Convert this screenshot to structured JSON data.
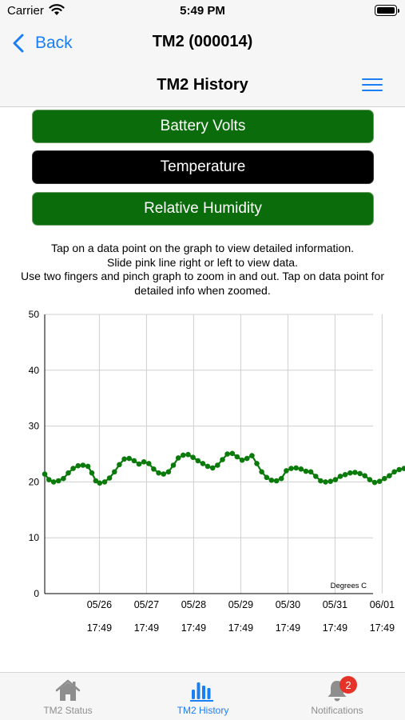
{
  "status_bar": {
    "carrier": "Carrier",
    "time": "5:49 PM"
  },
  "nav": {
    "back_label": "Back",
    "title": "TM2 (000014)"
  },
  "header": {
    "title": "TM2 History"
  },
  "buttons": {
    "battery": "Battery Volts",
    "temperature": "Temperature",
    "humidity": "Relative Humidity"
  },
  "colors": {
    "accent": "#1a7ef5",
    "button_green": "#0a6c0a",
    "button_selected": "#000000",
    "series": "#0a7a0a",
    "badge": "#e5332a"
  },
  "instructions": {
    "line1": "Tap on a data point on the graph to view detailed information.",
    "line2": "Slide pink line right or left to view data.",
    "line3": "Use two fingers and pinch graph to zoom in and out. Tap on data point for detailed info when zoomed."
  },
  "chart_data": {
    "type": "scatter",
    "title": "",
    "xlabel": "",
    "ylabel": "",
    "unit_label": "Degrees C",
    "ylim": [
      0,
      50
    ],
    "yticks": [
      "0",
      "10",
      "20",
      "30",
      "40",
      "50"
    ],
    "xlim": [
      "05/25 14:00",
      "06/01 17:49"
    ],
    "xtick_dates": [
      "05/26",
      "05/27",
      "05/28",
      "05/29",
      "05/30",
      "05/31",
      "06/01"
    ],
    "xtick_times": [
      "17:49",
      "17:49",
      "17:49",
      "17:49",
      "17:49",
      "17:49",
      "17:49"
    ],
    "grid": true,
    "series": [
      {
        "points": [
          [
            "05/25 14:00",
            21.4
          ],
          [
            "05/25 16:10",
            20.4
          ],
          [
            "05/25 18:30",
            20.0
          ],
          [
            "05/25 21:00",
            20.2
          ],
          [
            "05/25 23:30",
            20.6
          ],
          [
            "05/26 02:00",
            21.6
          ],
          [
            "05/26 04:30",
            22.4
          ],
          [
            "05/26 07:00",
            22.9
          ],
          [
            "05/26 09:30",
            23.0
          ],
          [
            "05/26 12:00",
            22.8
          ],
          [
            "05/26 14:00",
            21.6
          ],
          [
            "05/26 16:00",
            20.2
          ],
          [
            "05/26 18:00",
            19.8
          ],
          [
            "05/26 20:30",
            20.0
          ],
          [
            "05/26 23:00",
            20.7
          ],
          [
            "05/27 01:30",
            21.8
          ],
          [
            "05/27 04:00",
            23.1
          ],
          [
            "05/27 06:30",
            24.1
          ],
          [
            "05/27 09:00",
            24.2
          ],
          [
            "05/27 11:30",
            23.8
          ],
          [
            "05/27 14:00",
            23.2
          ],
          [
            "05/27 16:30",
            23.6
          ],
          [
            "05/27 19:00",
            23.3
          ],
          [
            "05/27 21:30",
            22.3
          ],
          [
            "05/28 00:00",
            21.6
          ],
          [
            "05/28 02:30",
            21.4
          ],
          [
            "05/28 05:00",
            21.8
          ],
          [
            "05/28 07:30",
            23.0
          ],
          [
            "05/28 10:00",
            24.3
          ],
          [
            "05/28 12:30",
            24.8
          ],
          [
            "05/28 15:00",
            24.9
          ],
          [
            "05/28 17:30",
            24.4
          ],
          [
            "05/28 20:00",
            23.8
          ],
          [
            "05/28 22:30",
            23.3
          ],
          [
            "05/29 01:00",
            22.8
          ],
          [
            "05/29 03:30",
            22.5
          ],
          [
            "05/29 06:00",
            23.0
          ],
          [
            "05/29 08:30",
            24.0
          ],
          [
            "05/29 11:00",
            25.0
          ],
          [
            "05/29 13:30",
            25.1
          ],
          [
            "05/29 16:00",
            24.5
          ],
          [
            "05/29 18:30",
            23.9
          ],
          [
            "05/29 21:00",
            24.2
          ],
          [
            "05/29 23:30",
            24.7
          ],
          [
            "05/30 02:00",
            23.3
          ],
          [
            "05/30 04:30",
            21.8
          ],
          [
            "05/30 07:00",
            20.8
          ],
          [
            "05/30 09:30",
            20.3
          ],
          [
            "05/30 12:00",
            20.2
          ],
          [
            "05/30 14:30",
            20.6
          ],
          [
            "05/30 17:00",
            22.0
          ],
          [
            "05/30 19:30",
            22.4
          ],
          [
            "05/30 22:00",
            22.5
          ],
          [
            "05/31 00:30",
            22.3
          ],
          [
            "05/31 03:00",
            21.9
          ],
          [
            "05/31 05:30",
            21.8
          ],
          [
            "05/31 08:00",
            21.0
          ],
          [
            "05/31 10:30",
            20.2
          ],
          [
            "05/31 13:00",
            20.0
          ],
          [
            "05/31 15:30",
            20.1
          ],
          [
            "05/31 18:00",
            20.4
          ],
          [
            "05/31 20:30",
            21.0
          ],
          [
            "05/31 23:00",
            21.3
          ],
          [
            "06/01 01:30",
            21.6
          ],
          [
            "06/01 04:00",
            21.7
          ],
          [
            "06/01 06:30",
            21.5
          ],
          [
            "06/01 09:00",
            21.1
          ],
          [
            "06/01 11:30",
            20.4
          ],
          [
            "06/01 14:00",
            19.9
          ],
          [
            "06/01 16:30",
            20.1
          ],
          [
            "06/01 19:00",
            20.6
          ],
          [
            "06/01 21:30",
            21.1
          ],
          [
            "06/02 00:00",
            21.8
          ],
          [
            "06/02 02:30",
            22.2
          ],
          [
            "06/02 05:00",
            22.4
          ],
          [
            "06/02 07:30",
            22.4
          ],
          [
            "06/02 10:00",
            22.3
          ]
        ]
      }
    ]
  },
  "tabs": [
    {
      "label": "TM2 Status",
      "icon": "house-icon",
      "active": false
    },
    {
      "label": "TM2 History",
      "icon": "bar-chart-icon",
      "active": true
    },
    {
      "label": "Notifications",
      "icon": "bell-icon",
      "active": false,
      "badge": "2"
    }
  ]
}
